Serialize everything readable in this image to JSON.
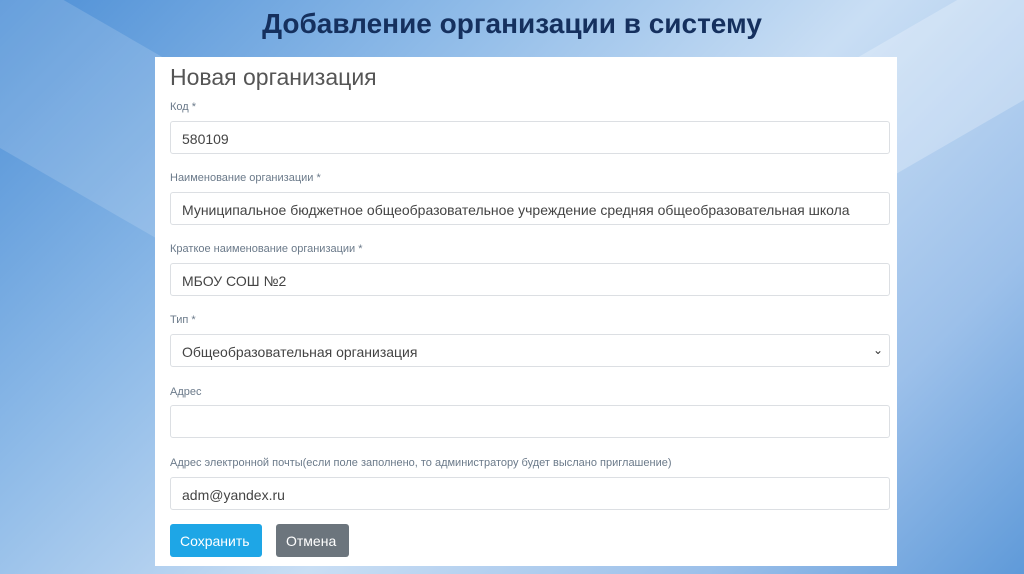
{
  "slide_title": "Добавление организации в систему",
  "form": {
    "title": "Новая организация",
    "fields": [
      {
        "label": "Код *",
        "value": "580109"
      },
      {
        "label": "Наименование организации *",
        "value": "Муниципальное бюджетное общеобразовательное учреждение средняя общеобразовательная школа"
      },
      {
        "label": "Краткое наименование организации *",
        "value": "МБОУ СОШ №2"
      },
      {
        "label": "Тип *",
        "value": "Общеобразовательная организация"
      },
      {
        "label": "Адрес",
        "value": ""
      },
      {
        "label": "Адрес электронной почты(если поле заполнено, то администратору будет выслано приглашение)",
        "value": "adm@yandex.ru"
      }
    ],
    "save_label": "Сохранить",
    "cancel_label": "Отмена"
  },
  "colors": {
    "save": "#1ea6e6",
    "cancel": "#6c757d",
    "title": "#15305e"
  }
}
